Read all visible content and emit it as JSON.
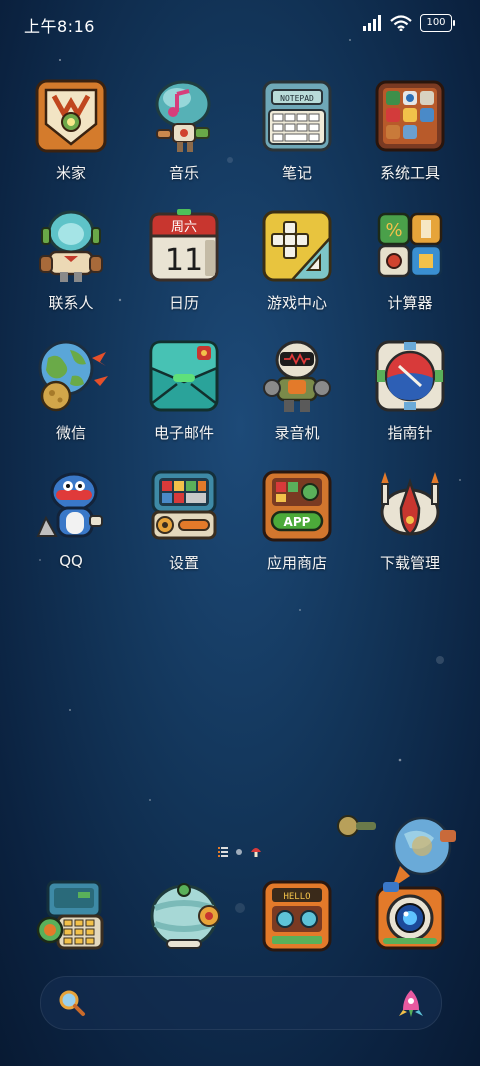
{
  "status": {
    "time": "上午8:16",
    "battery": "100"
  },
  "apps": [
    {
      "label": "米家",
      "icon": "mijia-icon"
    },
    {
      "label": "音乐",
      "icon": "music-icon"
    },
    {
      "label": "笔记",
      "icon": "notepad-icon",
      "icon_text": "NOTEPAD"
    },
    {
      "label": "系统工具",
      "icon": "system-tools-icon"
    },
    {
      "label": "联系人",
      "icon": "contacts-icon"
    },
    {
      "label": "日历",
      "icon": "calendar-icon",
      "icon_weekday": "周六",
      "icon_day": "11"
    },
    {
      "label": "游戏中心",
      "icon": "game-center-icon"
    },
    {
      "label": "计算器",
      "icon": "calculator-icon"
    },
    {
      "label": "微信",
      "icon": "wechat-icon"
    },
    {
      "label": "电子邮件",
      "icon": "email-icon"
    },
    {
      "label": "录音机",
      "icon": "recorder-icon"
    },
    {
      "label": "指南针",
      "icon": "compass-icon"
    },
    {
      "label": "QQ",
      "icon": "qq-icon"
    },
    {
      "label": "设置",
      "icon": "settings-icon"
    },
    {
      "label": "应用商店",
      "icon": "app-store-icon",
      "icon_text": "APP"
    },
    {
      "label": "下载管理",
      "icon": "download-manager-icon"
    }
  ],
  "dock": [
    {
      "icon": "phone-icon"
    },
    {
      "icon": "messages-icon"
    },
    {
      "icon": "browser-icon",
      "icon_text": "HELLO"
    },
    {
      "icon": "camera-icon"
    }
  ],
  "colors": {
    "background_top": "#1d4a78",
    "background_bottom": "#081a33"
  }
}
